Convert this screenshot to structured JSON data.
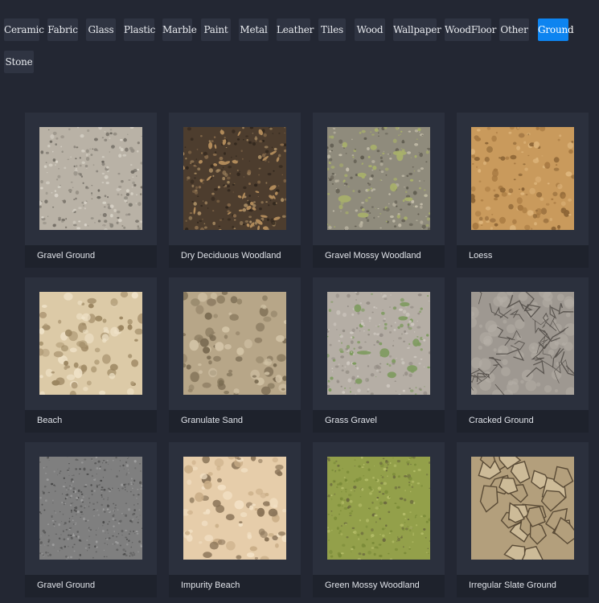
{
  "categories": {
    "items": [
      {
        "label": "Ceramic",
        "active": false
      },
      {
        "label": "Fabric",
        "active": false
      },
      {
        "label": "Glass",
        "active": false
      },
      {
        "label": "Plastic",
        "active": false
      },
      {
        "label": "Marble",
        "active": false
      },
      {
        "label": "Paint",
        "active": false
      },
      {
        "label": "Metal",
        "active": false
      },
      {
        "label": "Leather",
        "active": false
      },
      {
        "label": "Tiles",
        "active": false
      },
      {
        "label": "Wood",
        "active": false
      },
      {
        "label": "Wallpaper",
        "active": false
      },
      {
        "label": "WoodFloor",
        "active": false
      },
      {
        "label": "Other",
        "active": false
      },
      {
        "label": "Ground",
        "active": true
      },
      {
        "label": "Stone",
        "active": false
      }
    ],
    "active_color": "#0d84f0"
  },
  "materials": {
    "items": [
      {
        "name": "Gravel Ground",
        "texture": "gravel-light",
        "base": "#b9b2a6",
        "spots": [
          "#8f897f",
          "#d8d3c8",
          "#6f6a62"
        ]
      },
      {
        "name": "Dry Deciduous Woodland",
        "texture": "soil-leaves",
        "base": "#4d3d2e",
        "spots": [
          "#8a6d4c",
          "#2f251c",
          "#a88b62"
        ]
      },
      {
        "name": "Gravel Mossy Woodland",
        "texture": "mossy-gravel",
        "base": "#8f8b7c",
        "spots": [
          "#a8b06a",
          "#605c50",
          "#c2bca9"
        ]
      },
      {
        "name": "Loess",
        "texture": "loess",
        "base": "#c99a5c",
        "spots": [
          "#a87a42",
          "#ddb47a",
          "#8d6536"
        ]
      },
      {
        "name": "Beach",
        "texture": "beach-sand",
        "base": "#dccaa7",
        "spots": [
          "#b19c78",
          "#efe2c8",
          "#9a845f"
        ]
      },
      {
        "name": "Granulate Sand",
        "texture": "granulate-sand",
        "base": "#b7a688",
        "spots": [
          "#8f7f64",
          "#d2c3a6",
          "#7a6b52"
        ]
      },
      {
        "name": "Grass Gravel",
        "texture": "grass-gravel",
        "base": "#b5aea5",
        "spots": [
          "#7d9a5e",
          "#938c84",
          "#cfc9c1"
        ]
      },
      {
        "name": "Cracked Ground",
        "texture": "cracked",
        "base": "#9e9891",
        "spots": [
          "#6a655f",
          "#b5afa8",
          "#5a5550"
        ]
      },
      {
        "name": "Gravel Ground",
        "texture": "gravel-dark",
        "base": "#7f7f7f",
        "spots": [
          "#5e5e5e",
          "#a0a0a0",
          "#4a4a4a"
        ]
      },
      {
        "name": "Impurity Beach",
        "texture": "impurity-beach",
        "base": "#e6cdaa",
        "spots": [
          "#c9ad86",
          "#f2e0c4",
          "#8a7458"
        ]
      },
      {
        "name": "Green Mossy Woodland",
        "texture": "green-moss",
        "base": "#93a04a",
        "spots": [
          "#7a8a38",
          "#b4bd68",
          "#6b6a3e"
        ]
      },
      {
        "name": "Irregular Slate Ground",
        "texture": "slate",
        "base": "#b39f7c",
        "spots": [
          "#7c6a4d",
          "#cdbb98",
          "#5a4b36"
        ]
      }
    ]
  }
}
